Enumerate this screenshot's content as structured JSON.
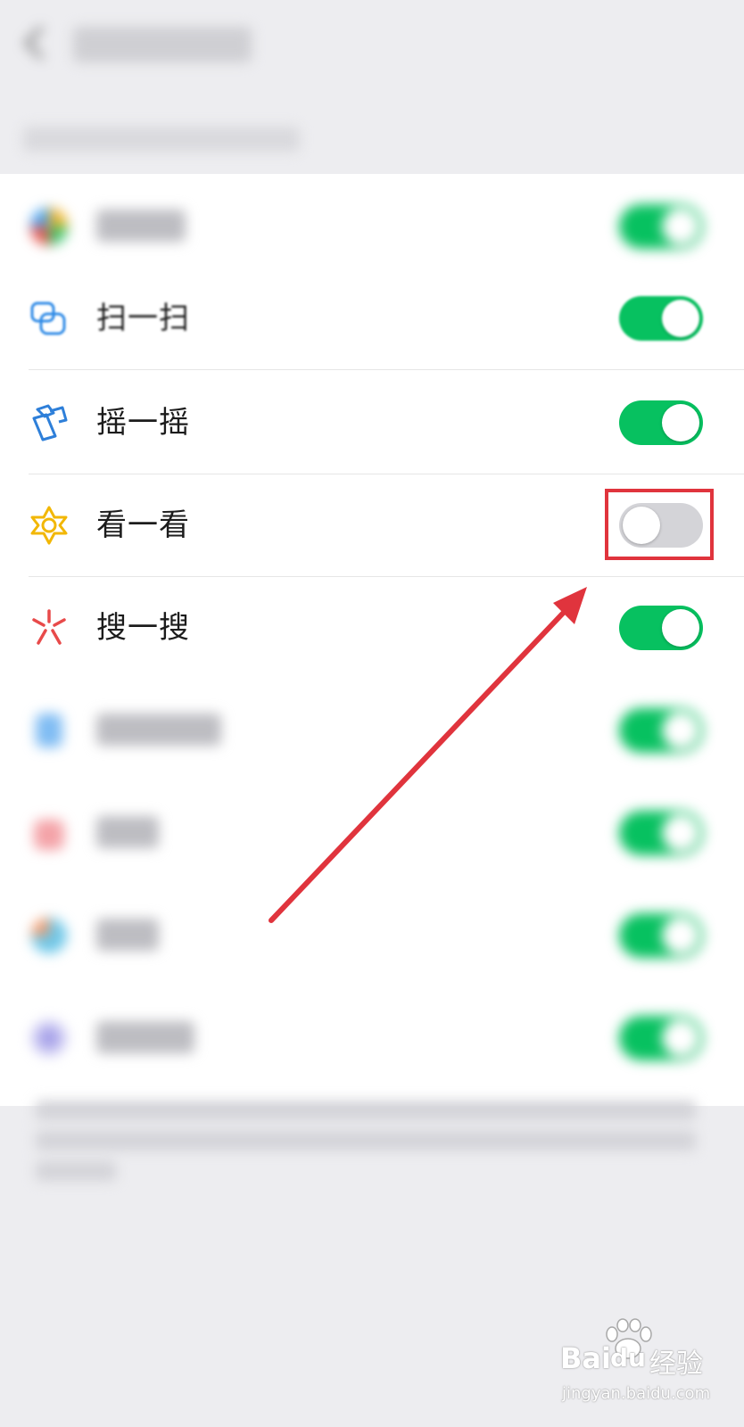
{
  "rows": [
    {
      "label": "扫一扫",
      "toggle": true
    },
    {
      "label": "摇一摇",
      "toggle": true
    },
    {
      "label": "看一看",
      "toggle": false
    },
    {
      "label": "搜一搜",
      "toggle": true
    }
  ],
  "watermark": {
    "brand": "Bai",
    "brand2": "du",
    "cn": "经验",
    "url": "jingyan.baidu.com"
  },
  "colors": {
    "switch_on": "#07c160",
    "switch_off": "#d4d4d8",
    "highlight": "#e0343d",
    "arrow": "#e0343d"
  },
  "icons": [
    "scan-icon",
    "shake-icon",
    "look-icon",
    "search-icon"
  ]
}
